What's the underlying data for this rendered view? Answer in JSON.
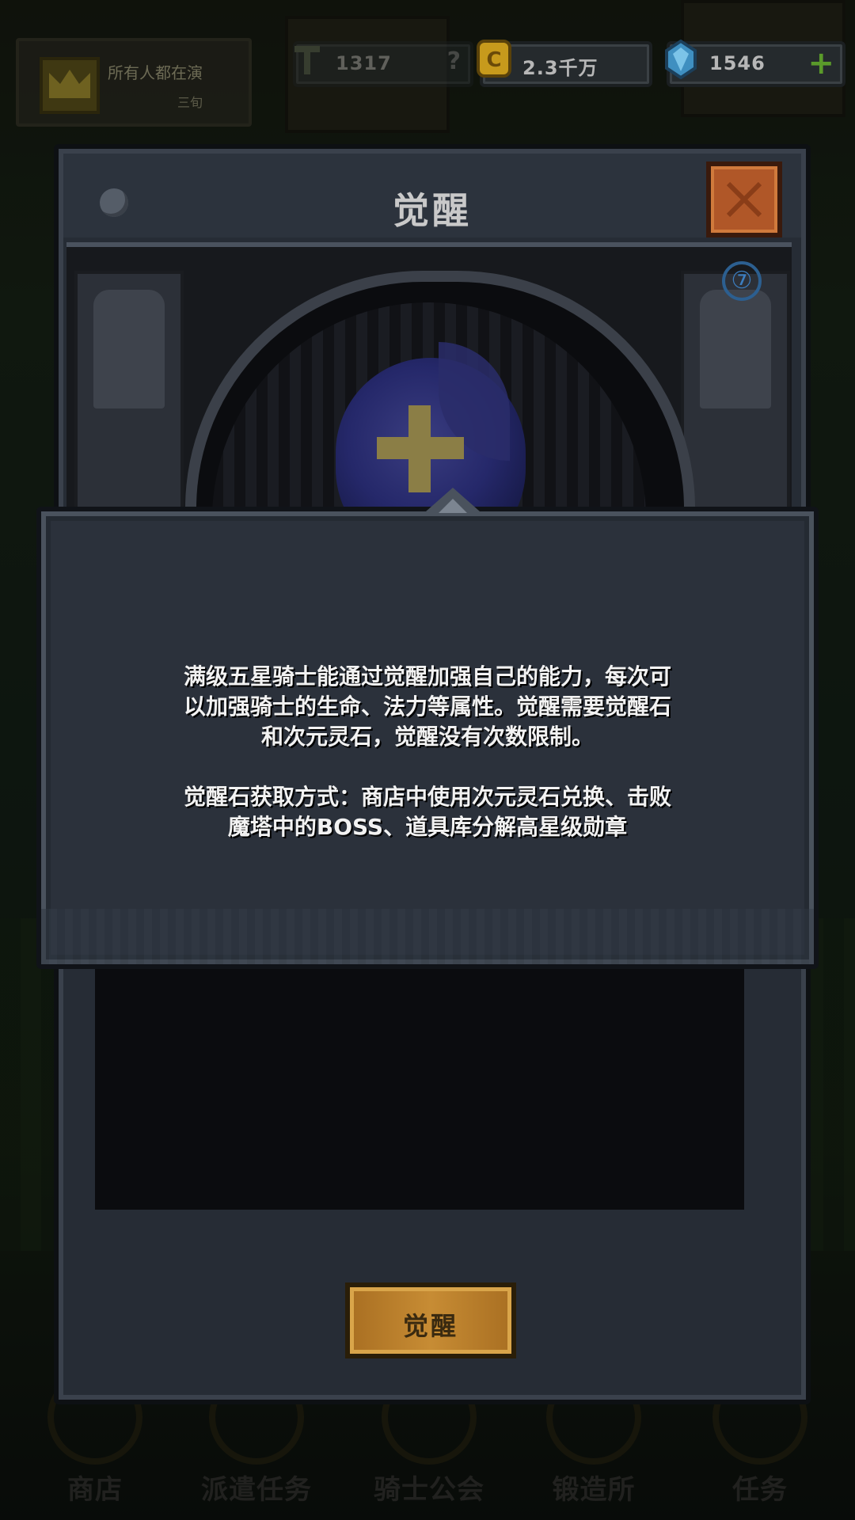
{
  "hud": {
    "player_name": "所有人都在演",
    "player_sub": "三旬",
    "power_value": "1317",
    "power_help": "?",
    "gold_value": "2.3千万",
    "gem_value": "1546",
    "gem_add": "+"
  },
  "dialog": {
    "title": "觉醒",
    "rune_badge": "⑦",
    "awaken_button": "觉醒"
  },
  "info": {
    "line1": "满级五星骑士能通过觉醒加强自己的能力，每次可",
    "line2": "以加强骑士的生命、法力等属性。觉醒需要觉醒石",
    "line3": "和次元灵石，觉醒没有次数限制。",
    "line4": "觉醒石获取方式：商店中使用次元灵石兑换、击败",
    "line5": "魔塔中的BOSS、道具库分解高星级勋章"
  },
  "nav": {
    "items": [
      {
        "label": "商店"
      },
      {
        "label": "派遣任务"
      },
      {
        "label": "骑士公会"
      },
      {
        "label": "锻造所"
      },
      {
        "label": "任务"
      }
    ]
  },
  "colors": {
    "panel": "#2b313b",
    "close": "#b05728",
    "gold_button": "#c78c34",
    "gem_plus": "#5a9a2a"
  }
}
